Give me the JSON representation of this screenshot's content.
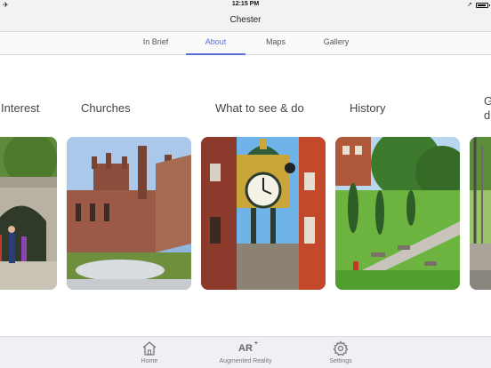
{
  "status_bar": {
    "time": "12:15 PM",
    "battery_level": 0.85
  },
  "nav": {
    "title": "Chester"
  },
  "tabs": [
    {
      "label": "In Brief",
      "active": false
    },
    {
      "label": "About",
      "active": true
    },
    {
      "label": "Maps",
      "active": false
    },
    {
      "label": "Gallery",
      "active": false
    }
  ],
  "cards": [
    {
      "title": "Interest",
      "image": "city-walls-gate-photo"
    },
    {
      "title": "Churches",
      "image": "cathedral-photo"
    },
    {
      "title": "What to see & do",
      "image": "eastgate-clock-photo"
    },
    {
      "title": "History",
      "image": "roman-garden-photo"
    },
    {
      "title_line1": "G",
      "title_line2": "d",
      "image": "bridge-photo"
    }
  ],
  "bottom_tabs": [
    {
      "label": "Home",
      "icon": "home-icon"
    },
    {
      "label": "Augmented Reality",
      "icon": "ar-icon",
      "glyph": "AR",
      "glyph_sup": "+"
    },
    {
      "label": "Settings",
      "icon": "gear-icon"
    }
  ],
  "colors": {
    "accent": "#5b6fd6",
    "bar_bg": "#f2f2f5",
    "tab_bar_bg": "#eef0f3"
  }
}
